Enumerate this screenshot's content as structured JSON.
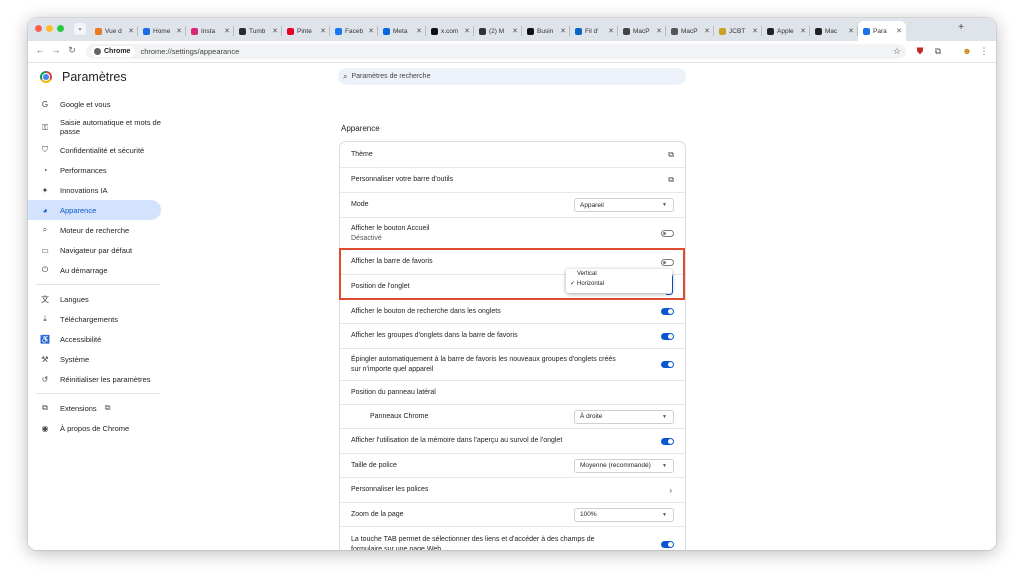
{
  "window_controls": {
    "close": "#ff5f57",
    "minimize": "#febc2e",
    "maximize": "#28c840"
  },
  "tabs": [
    {
      "title": "Vue d",
      "icon": "play-icon",
      "color": "#e67c22"
    },
    {
      "title": "Home",
      "icon": "b-icon",
      "color": "#1d6ae5"
    },
    {
      "title": "Insta",
      "icon": "instagram-icon",
      "color": "#d62976"
    },
    {
      "title": "Tumb",
      "icon": "tumblr-icon",
      "color": "#2b2b2b"
    },
    {
      "title": "Pinte",
      "icon": "pinterest-icon",
      "color": "#e60023"
    },
    {
      "title": "Faceb",
      "icon": "facebook-icon",
      "color": "#1877f2"
    },
    {
      "title": "Meta",
      "icon": "meta-icon",
      "color": "#0668e1"
    },
    {
      "title": "x.com",
      "icon": "x-icon",
      "color": "#111111"
    },
    {
      "title": "(2) M",
      "icon": "threads-icon",
      "color": "#333333"
    },
    {
      "title": "Busin",
      "icon": "tiktok-icon",
      "color": "#111111"
    },
    {
      "title": "Fil d'",
      "icon": "linkedin-icon",
      "color": "#0a66c2"
    },
    {
      "title": "MacP",
      "icon": "apple-icon",
      "color": "#444444"
    },
    {
      "title": "MacP",
      "icon": "macp-icon",
      "color": "#555555"
    },
    {
      "title": "JCBT",
      "icon": "jcbt-icon",
      "color": "#c9a227"
    },
    {
      "title": "Apple",
      "icon": "apple-dot-icon",
      "color": "#222222"
    },
    {
      "title": "Mac",
      "icon": "apple-dot-icon",
      "color": "#222222"
    },
    {
      "title": "Para",
      "icon": "gear-icon",
      "color": "#1a73e8",
      "active": true
    }
  ],
  "toolbar": {
    "chip_label": "Chrome",
    "url": "chrome://settings/appearance"
  },
  "brand": {
    "title": "Paramètres"
  },
  "search": {
    "placeholder": "Paramètres de recherche"
  },
  "sidebar": {
    "group1": [
      {
        "label": "Google et vous",
        "icon": "google-icon",
        "glyph": "G"
      },
      {
        "label": "Saisie automatique et mots de passe",
        "icon": "key-icon",
        "glyph": "⚿",
        "two": true
      },
      {
        "label": "Confidentialité et sécurité",
        "icon": "shield-icon",
        "glyph": "⛉"
      },
      {
        "label": "Performances",
        "icon": "speedometer-icon",
        "glyph": "◔"
      },
      {
        "label": "Innovations IA",
        "icon": "sparkle-icon",
        "glyph": "✦"
      },
      {
        "label": "Apparence",
        "icon": "palette-icon",
        "glyph": "◕",
        "active": true
      },
      {
        "label": "Moteur de recherche",
        "icon": "search-icon",
        "glyph": "⌕"
      },
      {
        "label": "Navigateur par défaut",
        "icon": "browser-icon",
        "glyph": "▭"
      },
      {
        "label": "Au démarrage",
        "icon": "power-icon",
        "glyph": "⏻"
      }
    ],
    "group2": [
      {
        "label": "Langues",
        "icon": "translate-icon",
        "glyph": "文"
      },
      {
        "label": "Téléchargements",
        "icon": "download-icon",
        "glyph": "⤓"
      },
      {
        "label": "Accessibilité",
        "icon": "accessibility-icon",
        "glyph": "♿"
      },
      {
        "label": "Système",
        "icon": "wrench-icon",
        "glyph": "⚒"
      },
      {
        "label": "Réinitialiser les paramètres",
        "icon": "reset-icon",
        "glyph": "↺"
      }
    ],
    "group3": [
      {
        "label": "Extensions",
        "icon": "puzzle-icon",
        "glyph": "⧉",
        "external": true
      },
      {
        "label": "À propos de Chrome",
        "icon": "chrome-icon",
        "glyph": "◉"
      }
    ]
  },
  "section_title": "Apparence",
  "rows": [
    {
      "label": "Thème",
      "control": "external"
    },
    {
      "label": "Personnaliser votre barre d'outils",
      "control": "external"
    },
    {
      "label": "Mode",
      "control": "select",
      "value": "Appareil"
    },
    {
      "label": "Afficher le bouton Accueil",
      "sub": "Désactivé",
      "control": "toggle",
      "on": false
    },
    {
      "label": "Afficher la barre de favoris",
      "control": "toggle",
      "on": false
    },
    {
      "label": "Position de l'onglet",
      "control": "none"
    },
    {
      "label": "Afficher le bouton de recherche dans les onglets",
      "control": "toggle",
      "on": true
    },
    {
      "label": "Afficher les groupes d'onglets dans la barre de favoris",
      "control": "toggle",
      "on": true
    },
    {
      "label": "Épingler automatiquement à la barre de favoris les nouveaux groupes d'onglets créés sur n'importe quel appareil",
      "control": "toggle",
      "on": true
    },
    {
      "label": "Position du panneau latéral",
      "control": "none"
    },
    {
      "label": "Panneaux Chrome",
      "control": "select",
      "value": "À droite",
      "indent": true
    },
    {
      "label": "Afficher l'utilisation de la mémoire dans l'aperçu au survol de l'onglet",
      "control": "toggle",
      "on": true
    },
    {
      "label": "Taille de police",
      "control": "select",
      "value": "Moyenne (recommandé)"
    },
    {
      "label": "Personnaliser les polices",
      "control": "arrow"
    },
    {
      "label": "Zoom de la page",
      "control": "select",
      "value": "100%"
    },
    {
      "label": "La touche TAB permet de sélectionner des liens et d'accéder à des champs de formulaire sur une page Web.",
      "control": "toggle",
      "on": true
    }
  ],
  "tab_position_popup": {
    "options": [
      "Vertical",
      "Horizontal"
    ],
    "selected": "Horizontal"
  }
}
